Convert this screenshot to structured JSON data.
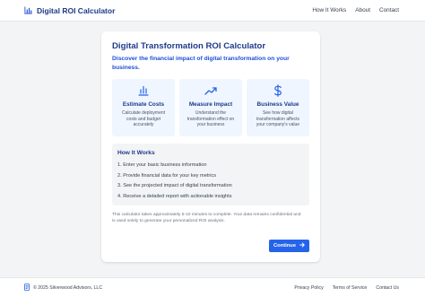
{
  "header": {
    "title": "Digital ROI Calculator",
    "logo_icon": "chart-bar-icon",
    "nav": [
      "How It Works",
      "About",
      "Contact"
    ]
  },
  "card": {
    "title": "Digital Transformation ROI Calculator",
    "subtitle": "Discover the financial impact of digital transformation on your business.",
    "features": [
      {
        "icon": "bar-chart-icon",
        "title": "Estimate Costs",
        "desc": "Calculate deployment costs and budget accurately"
      },
      {
        "icon": "trending-up-icon",
        "title": "Measure Impact",
        "desc": "Understand the transformation effect on your business"
      },
      {
        "icon": "dollar-icon",
        "title": "Business Value",
        "desc": "See how digital transformation affects your company's value"
      }
    ],
    "how_it_works": {
      "title": "How It Works",
      "steps": [
        "1. Enter your basic business information",
        "2. Provide financial data for your key metrics",
        "3. See the projected impact of digital transformation",
        "4. Receive a detailed report with actionable insights"
      ]
    },
    "disclaimer": "This calculator takes approximately 5-10 minutes to complete. Your data remains confidential and is used solely to generate your personalized ROI analysis.",
    "continue_label": "Continue"
  },
  "footer": {
    "copyright": "© 2025 Silverwood Advisors, LLC",
    "links": [
      "Privacy Policy",
      "Terms of Service",
      "Contact Us"
    ]
  },
  "colors": {
    "accent": "#2563eb",
    "heading": "#1e3a8a",
    "feature_bg": "#eff6ff"
  }
}
